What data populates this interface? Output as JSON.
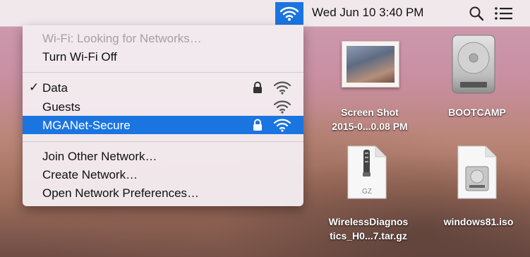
{
  "menubar": {
    "clock": "Wed Jun 10  3:40 PM",
    "icons": [
      "wifi-icon",
      "search-icon",
      "list-icon"
    ],
    "accent": "#1b75e1"
  },
  "wifi_menu": {
    "status": "Wi-Fi: Looking for Networks…",
    "toggle": "Turn Wi-Fi Off",
    "networks": [
      {
        "name": "Data",
        "checked": true,
        "locked": true
      },
      {
        "name": "Guests",
        "checked": false,
        "locked": false
      },
      {
        "name": "MGANet-Secure",
        "checked": false,
        "locked": true,
        "highlighted": true
      }
    ],
    "actions": [
      "Join Other Network…",
      "Create Network…",
      "Open Network Preferences…"
    ]
  },
  "desktop": {
    "items": [
      {
        "line1": "Screen Shot",
        "line2": "2015-0...0.08 PM",
        "icon": "screenshot-icon"
      },
      {
        "line1": "BOOTCAMP",
        "line2": "",
        "icon": "hard-drive-icon"
      },
      {
        "line1": "WirelessDiagnos",
        "line2": "tics_H0...7.tar.gz",
        "icon": "archive-icon",
        "badge": "GZ"
      },
      {
        "line1": "windows81.iso",
        "line2": "",
        "icon": "disk-image-icon"
      }
    ]
  }
}
